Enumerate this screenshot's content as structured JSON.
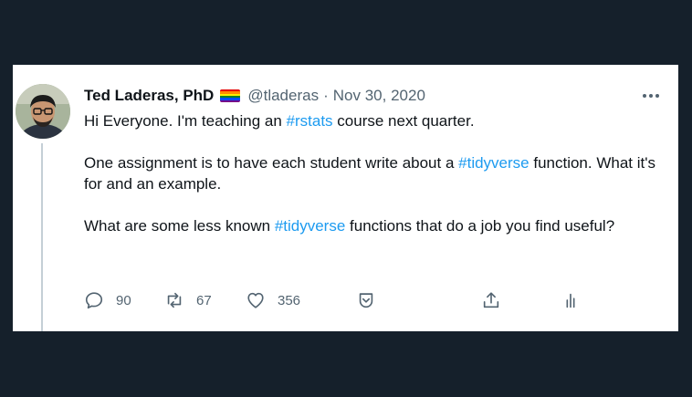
{
  "tweet": {
    "author_name": "Ted Laderas, PhD",
    "handle": "@tladeras",
    "separator": "·",
    "date": "Nov 30, 2020",
    "flag_colors": [
      "#e40303",
      "#ff8c00",
      "#ffed00",
      "#008026",
      "#004dff",
      "#750787"
    ],
    "line1": {
      "pre": "Hi Everyone. I'm teaching an ",
      "tag": "#rstats",
      "post": " course next quarter."
    },
    "line2": {
      "pre": "One assignment is to have each student write about a ",
      "tag": "#tidyverse",
      "post": " function. What it's for and an example."
    },
    "line3": {
      "pre": "What are some less known ",
      "tag": "#tidyverse",
      "post": " functions that do a job you find useful?"
    },
    "replies": "90",
    "retweets": "67",
    "likes": "356",
    "accent_color": "#1d9bf0",
    "icons": [
      "reply-icon",
      "retweet-icon",
      "like-icon",
      "bookmark-icon",
      "share-icon",
      "analytics-icon",
      "more-icon"
    ]
  }
}
